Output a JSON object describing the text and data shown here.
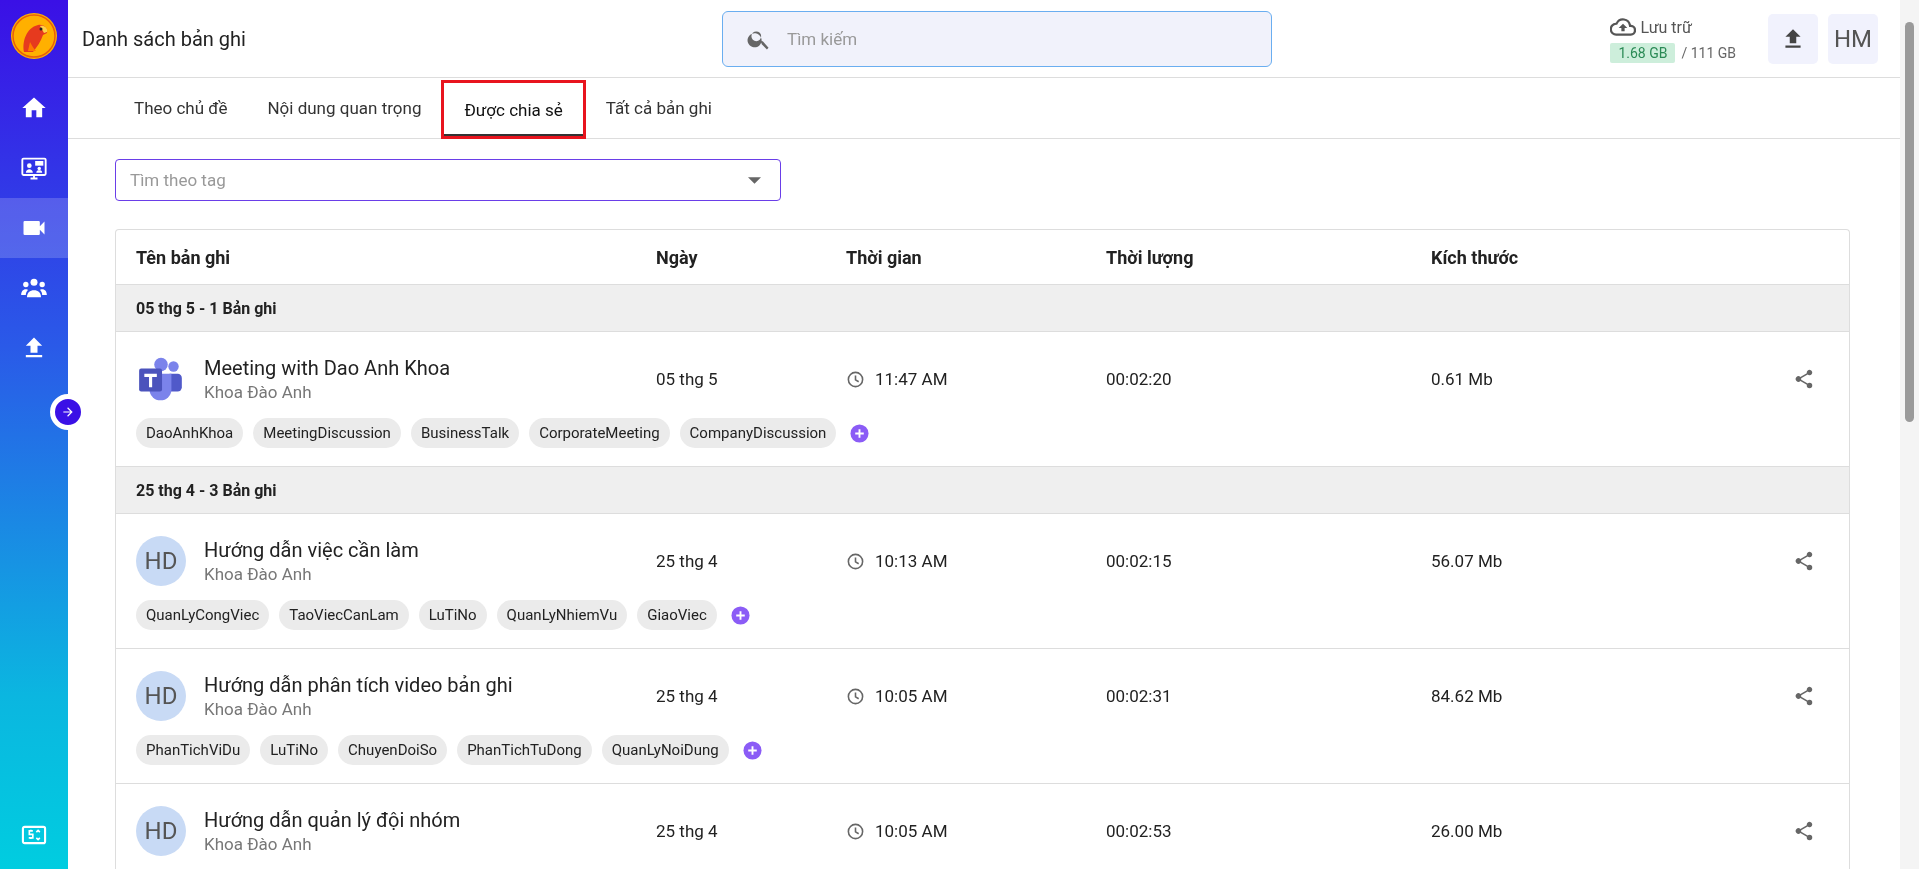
{
  "page_title": "Danh sách bản ghi",
  "search": {
    "placeholder": "Tìm kiếm"
  },
  "storage": {
    "label": "Lưu trữ",
    "used": "1.68 GB",
    "total": "/ 111 GB"
  },
  "user": {
    "initials": "HM"
  },
  "sidebar": {
    "items": [
      {
        "kind": "home",
        "selected": false
      },
      {
        "kind": "meeting",
        "selected": false
      },
      {
        "kind": "video",
        "selected": true
      },
      {
        "kind": "team",
        "selected": false
      },
      {
        "kind": "upload",
        "selected": false
      }
    ],
    "bottom_item": {
      "kind": "billing",
      "selected": false
    }
  },
  "tabs": [
    {
      "label": "Theo chủ đề",
      "selected": false
    },
    {
      "label": "Nội dung quan trọng",
      "selected": false
    },
    {
      "label": "Được chia sẻ",
      "selected": true
    },
    {
      "label": "Tất cả bản ghi",
      "selected": false
    }
  ],
  "tag_filter": {
    "placeholder": "Tìm theo tag"
  },
  "table": {
    "columns": [
      "Tên bản ghi",
      "Ngày",
      "Thời gian",
      "Thời lượng",
      "Kích thước"
    ],
    "groups": [
      {
        "label": "05 thg 5 - 1 Bản ghi",
        "records": [
          {
            "avatar": {
              "kind": "teams"
            },
            "title": "Meeting with Dao Anh Khoa",
            "owner": "Khoa Đào Anh",
            "date": "05 thg 5",
            "time": "11:47 AM",
            "duration": "00:02:20",
            "size": "0.61 Mb",
            "tags": [
              "DaoAnhKhoa",
              "MeetingDiscussion",
              "BusinessTalk",
              "CorporateMeeting",
              "CompanyDiscussion"
            ]
          }
        ]
      },
      {
        "label": "25 thg 4 - 3 Bản ghi",
        "records": [
          {
            "avatar": {
              "kind": "initials",
              "text": "HD"
            },
            "title": "Hướng dẫn việc cần làm",
            "owner": "Khoa Đào Anh",
            "date": "25 thg 4",
            "time": "10:13 AM",
            "duration": "00:02:15",
            "size": "56.07 Mb",
            "tags": [
              "QuanLyCongViec",
              "TaoViecCanLam",
              "LuTiNo",
              "QuanLyNhiemVu",
              "GiaoViec"
            ]
          },
          {
            "avatar": {
              "kind": "initials",
              "text": "HD"
            },
            "title": "Hướng dẫn phân tích video bản ghi",
            "owner": "Khoa Đào Anh",
            "date": "25 thg 4",
            "time": "10:05 AM",
            "duration": "00:02:31",
            "size": "84.62 Mb",
            "tags": [
              "PhanTichViDu",
              "LuTiNo",
              "ChuyenDoiSo",
              "PhanTichTuDong",
              "QuanLyNoiDung"
            ]
          },
          {
            "avatar": {
              "kind": "initials",
              "text": "HD"
            },
            "title": "Hướng dẫn quản lý đội nhóm",
            "owner": "Khoa Đào Anh",
            "date": "25 thg 4",
            "time": "10:05 AM",
            "duration": "00:02:53",
            "size": "26.00 Mb"
          }
        ]
      }
    ]
  }
}
